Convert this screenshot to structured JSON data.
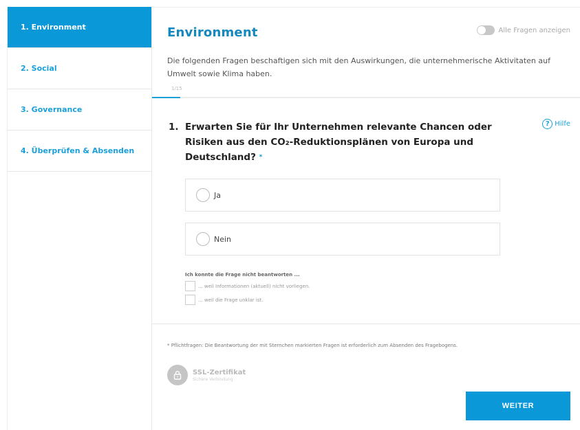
{
  "sidebar": {
    "items": [
      {
        "label": "1. Environment",
        "active": true
      },
      {
        "label": "2. Social",
        "active": false
      },
      {
        "label": "3. Governance",
        "active": false
      },
      {
        "label": "4. Überprüfen & Absenden",
        "active": false
      }
    ]
  },
  "main": {
    "title": "Environment",
    "toggle_label": "Alle Fragen anzeigen",
    "toggle_on": false,
    "intro": "Die folgenden Fragen beschaftigen sich mit den Auswirkungen, die unternehmerische Aktivitaten auf Umwelt sowie Klima haben.",
    "progress_text": "1/15",
    "progress_fraction": 0.0667,
    "question": {
      "number": "1.",
      "text": "Erwarten Sie für Ihr Unternehmen relevante Chancen oder Risiken aus den CO₂-Reduktionsplänen von Europa und Deutschland?",
      "required_mark": "*"
    },
    "help_label": "Hilfe",
    "options": [
      "Ja",
      "Nein"
    ],
    "cant_answer": {
      "title": "Ich konnte die Frage nicht beantworten ...",
      "options": [
        "... weil Informationen (aktuell) nicht vorliegen.",
        "... weil die Frage unklar ist."
      ]
    },
    "footnote": "* Pflichtfragen: Die Beantwortung der mit Sternchen markierten Fragen ist erforderlich zum Absenden des Fragebogens.",
    "ssl": {
      "title": "SSL-Zertifikat",
      "subtitle": "Sichere Verbindung"
    },
    "next_button": "WEITER"
  },
  "colors": {
    "accent": "#0b98d9",
    "title": "#1588bd",
    "link": "#1a9fd8"
  },
  "icons": {
    "help": "question-circle-icon",
    "ssl": "lock-icon"
  }
}
